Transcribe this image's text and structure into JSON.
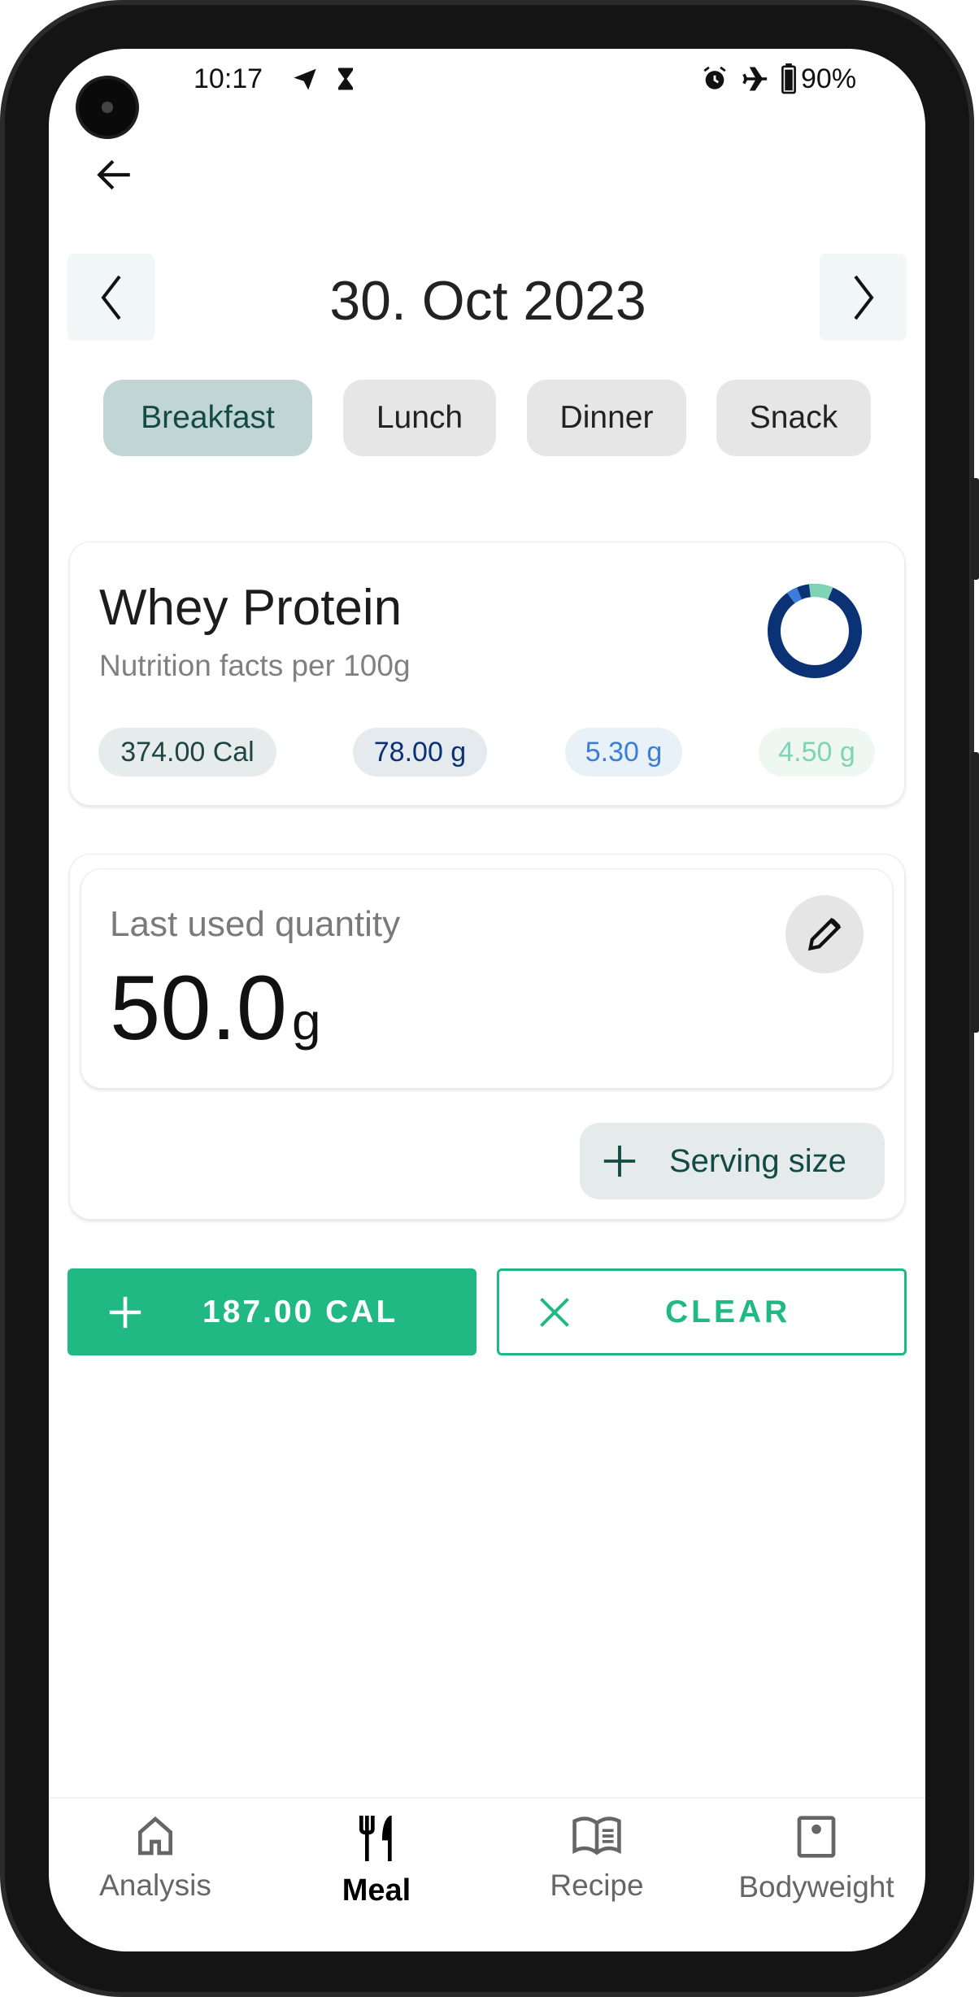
{
  "status_bar": {
    "time": "10:17",
    "battery": "90%",
    "icons": [
      "telegram-icon",
      "hourglass-icon",
      "alarm-icon",
      "airplane-icon",
      "battery-icon"
    ]
  },
  "header": {
    "back": "back-arrow-icon",
    "date": "30. Oct 2023"
  },
  "meal_tabs": [
    {
      "label": "Breakfast",
      "selected": true
    },
    {
      "label": "Lunch"
    },
    {
      "label": "Dinner"
    },
    {
      "label": "Snack"
    }
  ],
  "food": {
    "name": "Whey Protein",
    "subtitle": "Nutrition facts per 100g",
    "calories": "374.00 Cal",
    "protein": "78.00 g",
    "carbs": "5.30 g",
    "fat": "4.50 g",
    "colors": {
      "protein": "#0b3275",
      "carbs": "#3b7dd8",
      "fat": "#7dd5b3"
    }
  },
  "quantity": {
    "label": "Last used quantity",
    "value": "50.0",
    "unit": "g",
    "serving_size_label": "Serving size"
  },
  "actions": {
    "add_label": "187.00 CAL",
    "clear_label": "CLEAR",
    "accent": "#20b883"
  },
  "bottom_nav": [
    {
      "label": "Analysis"
    },
    {
      "label": "Meal",
      "active": true
    },
    {
      "label": "Recipe"
    },
    {
      "label": "Bodyweight"
    }
  ]
}
